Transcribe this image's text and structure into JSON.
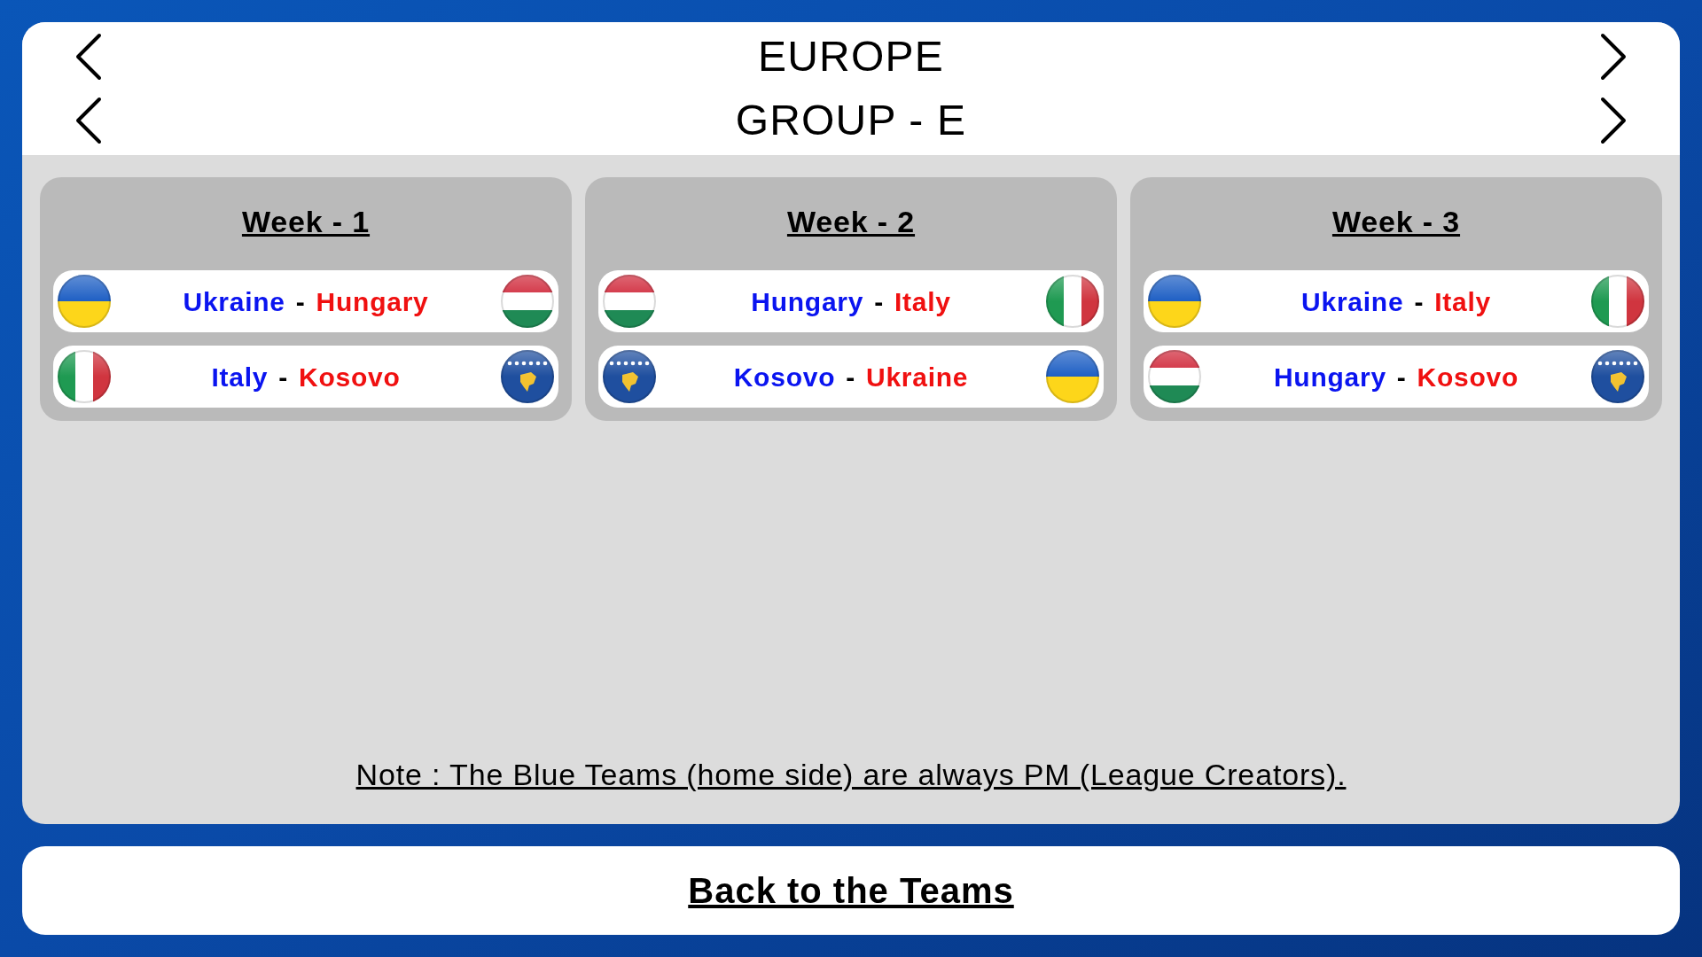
{
  "region": {
    "title": "EUROPE"
  },
  "group": {
    "title": "GROUP - E"
  },
  "weeks": [
    {
      "title": "Week - 1",
      "matches": [
        {
          "home": {
            "name": "Ukraine",
            "kind": "ua"
          },
          "separator": "-",
          "away": {
            "name": "Hungary",
            "kind": "hu"
          }
        },
        {
          "home": {
            "name": "Italy",
            "kind": "it"
          },
          "separator": "-",
          "away": {
            "name": "Kosovo",
            "kind": "xk"
          }
        }
      ]
    },
    {
      "title": "Week - 2",
      "matches": [
        {
          "home": {
            "name": "Hungary",
            "kind": "hu"
          },
          "separator": "-",
          "away": {
            "name": "Italy",
            "kind": "it"
          }
        },
        {
          "home": {
            "name": "Kosovo",
            "kind": "xk"
          },
          "separator": "-",
          "away": {
            "name": "Ukraine",
            "kind": "ua"
          }
        }
      ]
    },
    {
      "title": "Week - 3",
      "matches": [
        {
          "home": {
            "name": "Ukraine",
            "kind": "ua"
          },
          "separator": "-",
          "away": {
            "name": "Italy",
            "kind": "it"
          }
        },
        {
          "home": {
            "name": "Hungary",
            "kind": "hu"
          },
          "separator": "-",
          "away": {
            "name": "Kosovo",
            "kind": "xk"
          }
        }
      ]
    }
  ],
  "note": "Note : The Blue Teams (home side) are always PM (League Creators).",
  "back_button": "Back to the Teams"
}
